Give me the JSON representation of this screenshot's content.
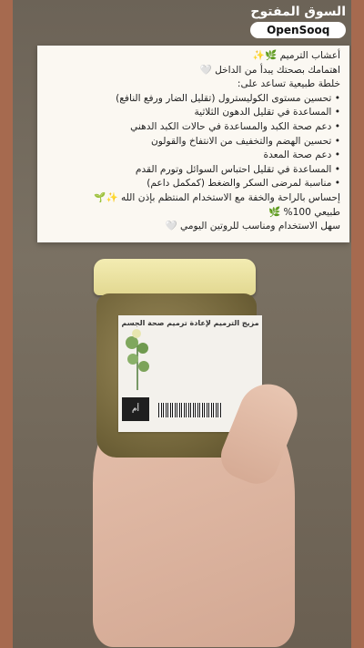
{
  "watermark": {
    "arabic": "السوق المفتوح",
    "english": "OpenSooq"
  },
  "card": {
    "lines": [
      "أعشاب الترميم 🌿✨",
      "اهتمامك بصحتك يبدأ من الداخل 🤍",
      "خلطة طبيعية تساعد على:",
      "تحسين مستوى الكوليسترول (تقليل الضار ورفع النافع)",
      "المساعدة في تقليل الدهون الثلاثية",
      "دعم صحة الكبد والمساعدة في حالات الكبد الدهني",
      "تحسين الهضم والتخفيف من الانتفاخ والقولون",
      "دعم صحة المعدة",
      "المساعدة في تقليل احتباس السوائل وتورم القدم",
      "مناسبة لمرضى السكر والضغط (كمكمل داعم)",
      "إحساس بالراحة والخفة مع الاستخدام المنتظم بإذن الله ✨🌱",
      "طبيعي 100% 🌿",
      "سهل الاستخدام ومناسب للروتين اليومي 🤍"
    ]
  },
  "jar_label": {
    "title": "مزيج الترميم لإعادة ترميم صحة الجسم",
    "brand": "أم"
  },
  "colors": {
    "background": "#7a6a58",
    "card": "#fbf8f2",
    "lid": "#ece2a2",
    "side_bars": "#a66a4f"
  }
}
